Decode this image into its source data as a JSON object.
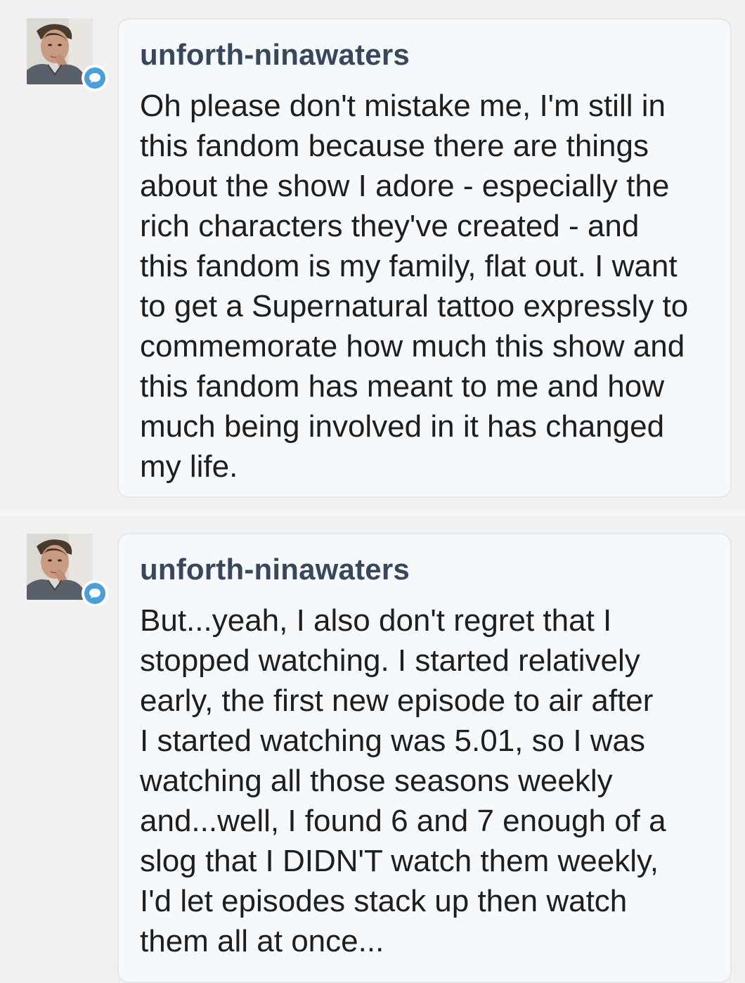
{
  "messages": [
    {
      "username": "unforth-ninawaters",
      "text": "Oh please don't mistake me, I'm still in\nthis fandom because there are things\nabout the show I adore - especially the\nrich characters they've created - and\nthis fandom is my family, flat out. I want\nto get a Supernatural tattoo expressly to\ncommemorate how much this show and\nthis fandom has meant to me and how\nmuch being involved in it has changed\nmy life."
    },
    {
      "username": "unforth-ninawaters",
      "text": "But...yeah, I also don't regret that I\nstopped watching. I started relatively\nearly, the first new episode to air after\nI started watching was 5.01, so I was\nwatching all those seasons weekly\nand...well, I found 6 and 7 enough of a\nslog that I DIDN'T watch them weekly,\nI'd let episodes stack up then watch\nthem all at once..."
    }
  ],
  "icons": {
    "badge": "chat-bubble-icon",
    "avatar": "user-avatar"
  },
  "colors": {
    "background": "#f1f1f1",
    "bubble_background": "#f6f9fc",
    "bubble_border": "#e3e8ee",
    "username": "#38475a",
    "text": "#1e1e1e",
    "badge": "#4a9fd8"
  }
}
